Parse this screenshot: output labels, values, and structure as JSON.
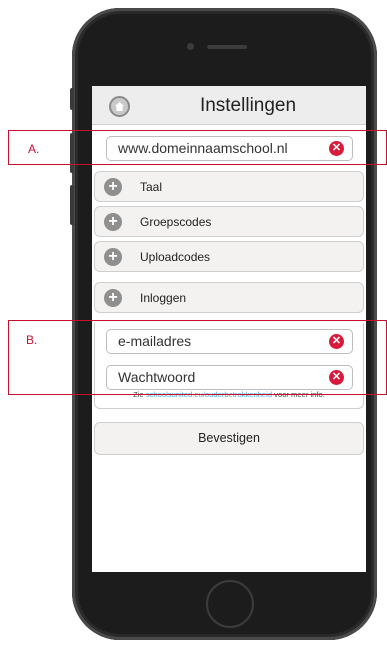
{
  "header": {
    "title": "Instellingen",
    "home_icon": "home-icon"
  },
  "domain_field": {
    "value": "www.domeinnaamschool.nl"
  },
  "sections": [
    {
      "label": "Taal"
    },
    {
      "label": "Groepscodes"
    },
    {
      "label": "Uploadcodes"
    },
    {
      "label": "Inloggen"
    }
  ],
  "login": {
    "email_placeholder": "e-mailadres",
    "password_placeholder": "Wachtwoord"
  },
  "info": {
    "prefix": "Zie ",
    "link": "schoolsunited.eu/ouderbetrokkenheid",
    "suffix": " voor meer info."
  },
  "confirm_label": "Bevestigen",
  "annotations": {
    "a": "A.",
    "b": "B."
  },
  "colors": {
    "annotation": "#c8102e",
    "clear": "#d81b3c",
    "link": "#4aa8d8"
  }
}
